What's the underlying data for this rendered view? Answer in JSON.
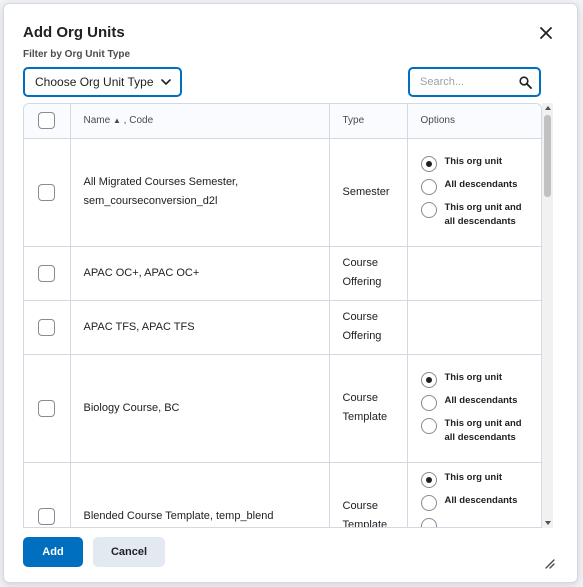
{
  "dialog": {
    "title": "Add Org Units",
    "filter_label": "Filter by Org Unit Type",
    "filter_select": "Choose Org Unit Type",
    "search_placeholder": "Search...",
    "search_value": ""
  },
  "table": {
    "headers": {
      "name": "Name",
      "sort_indicator": "▲",
      "code": ", Code",
      "type": "Type",
      "options": "Options"
    },
    "rows": [
      {
        "name_line1": "All Migrated Courses Semester,",
        "name_line2": "sem_courseconversion_d2l",
        "type_line1": "Semester",
        "type_line2": "",
        "options": [
          {
            "label_line1": "This org unit",
            "label_line2": "",
            "selected": true
          },
          {
            "label_line1": "All descendants",
            "label_line2": "",
            "selected": false
          },
          {
            "label_line1": "This org unit and",
            "label_line2": "all descendants",
            "selected": false
          }
        ]
      },
      {
        "name_line1": "APAC OC+, APAC OC+",
        "name_line2": "",
        "type_line1": "Course",
        "type_line2": "Offering",
        "options": []
      },
      {
        "name_line1": "APAC TFS, APAC TFS",
        "name_line2": "",
        "type_line1": "Course",
        "type_line2": "Offering",
        "options": []
      },
      {
        "name_line1": "Biology Course, BC",
        "name_line2": "",
        "type_line1": "Course",
        "type_line2": "Template",
        "options": [
          {
            "label_line1": "This org unit",
            "label_line2": "",
            "selected": true
          },
          {
            "label_line1": "All descendants",
            "label_line2": "",
            "selected": false
          },
          {
            "label_line1": "This org unit and",
            "label_line2": "all descendants",
            "selected": false
          }
        ]
      },
      {
        "name_line1": "Blended Course Template, temp_blend",
        "name_line2": "",
        "type_line1": "Course",
        "type_line2": "Template",
        "options": [
          {
            "label_line1": "This org unit",
            "label_line2": "",
            "selected": true
          },
          {
            "label_line1": "All descendants",
            "label_line2": "",
            "selected": false
          }
        ]
      }
    ]
  },
  "footer": {
    "add_label": "Add",
    "cancel_label": "Cancel"
  },
  "colors": {
    "primary": "#006fbf",
    "border": "#d3d9e3",
    "text": "#202122",
    "secondary_button": "#e3e9f1"
  },
  "icons": {
    "close": "close-icon",
    "chevron": "chevron-down-icon",
    "search": "search-icon",
    "resize": "resize-handle-icon"
  }
}
